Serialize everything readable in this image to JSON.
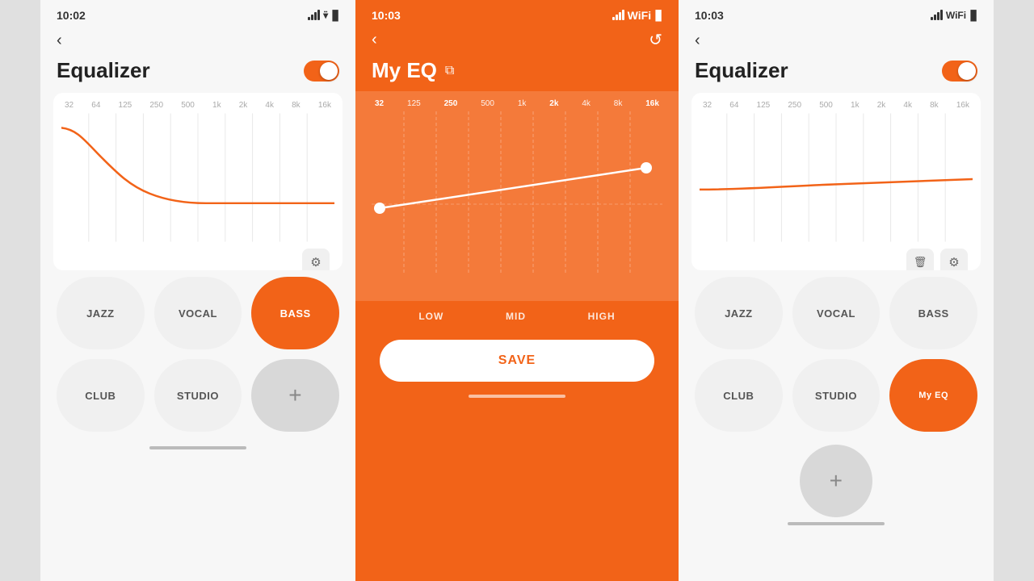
{
  "phones": {
    "left": {
      "status_time": "10:02",
      "title": "Equalizer",
      "toggle_on": true,
      "freq_labels": [
        "32",
        "64",
        "125",
        "250",
        "500",
        "1k",
        "2k",
        "4k",
        "8k",
        "16k"
      ],
      "presets": [
        {
          "label": "JAZZ",
          "active": false
        },
        {
          "label": "VOCAL",
          "active": false
        },
        {
          "label": "BASS",
          "active": true
        },
        {
          "label": "CLUB",
          "active": false
        },
        {
          "label": "STUDIO",
          "active": false
        },
        {
          "label": "+",
          "add": true
        }
      ]
    },
    "center": {
      "status_time": "10:03",
      "title": "My EQ",
      "freq_labels": [
        "32",
        "125",
        "250",
        "500",
        "1k",
        "2k",
        "4k",
        "8k",
        "16k"
      ],
      "freq_active": [
        "32",
        "16k"
      ],
      "bands": [
        "LOW",
        "MID",
        "HIGH"
      ],
      "save_label": "SAVE"
    },
    "right": {
      "status_time": "10:03",
      "title": "Equalizer",
      "toggle_on": true,
      "freq_labels": [
        "32",
        "64",
        "125",
        "250",
        "500",
        "1k",
        "2k",
        "4k",
        "8k",
        "16k"
      ],
      "presets": [
        {
          "label": "JAZZ",
          "active": false
        },
        {
          "label": "VOCAL",
          "active": false
        },
        {
          "label": "BASS",
          "active": false
        },
        {
          "label": "CLUB",
          "active": false
        },
        {
          "label": "STUDIO",
          "active": false
        },
        {
          "label": "My EQ",
          "active": true
        }
      ]
    }
  },
  "icons": {
    "back": "‹",
    "reset": "↺",
    "edit": "⧉",
    "gear": "⚙",
    "trash": "🗑",
    "plus": "+"
  }
}
